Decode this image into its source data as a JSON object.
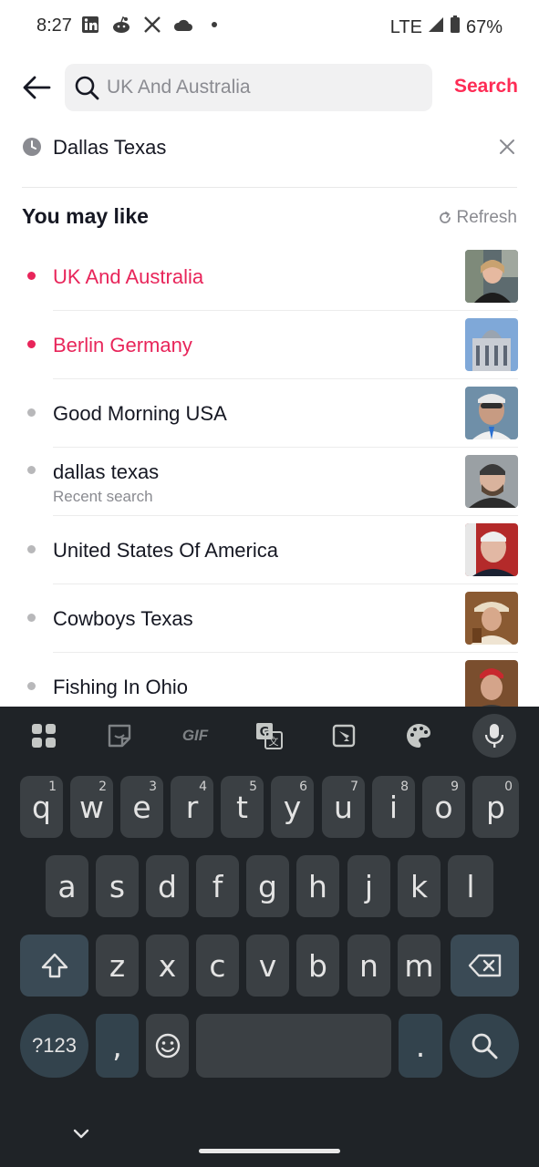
{
  "status_bar": {
    "time": "8:27",
    "network": "LTE",
    "battery": "67%"
  },
  "search": {
    "placeholder": "UK And Australia",
    "button_label": "Search"
  },
  "recent_search": {
    "label": "Dallas Texas"
  },
  "suggestions_section": {
    "title": "You may like",
    "refresh_label": "Refresh"
  },
  "suggestions": [
    {
      "text": "UK And Australia",
      "hot": true
    },
    {
      "text": "Berlin Germany",
      "hot": true
    },
    {
      "text": "Good Morning USA",
      "hot": false
    },
    {
      "text": "dallas texas",
      "subtext": "Recent search",
      "hot": false
    },
    {
      "text": "United States Of America",
      "hot": false
    },
    {
      "text": "Cowboys Texas",
      "hot": false
    },
    {
      "text": "Fishing In Ohio",
      "hot": false
    }
  ],
  "keyboard": {
    "toolbar_gif": "GIF",
    "row1": [
      {
        "key": "q",
        "hint": "1"
      },
      {
        "key": "w",
        "hint": "2"
      },
      {
        "key": "e",
        "hint": "3"
      },
      {
        "key": "r",
        "hint": "4"
      },
      {
        "key": "t",
        "hint": "5"
      },
      {
        "key": "y",
        "hint": "6"
      },
      {
        "key": "u",
        "hint": "7"
      },
      {
        "key": "i",
        "hint": "8"
      },
      {
        "key": "o",
        "hint": "9"
      },
      {
        "key": "p",
        "hint": "0"
      }
    ],
    "row2": [
      "a",
      "s",
      "d",
      "f",
      "g",
      "h",
      "j",
      "k",
      "l"
    ],
    "row3": [
      "z",
      "x",
      "c",
      "v",
      "b",
      "n",
      "m"
    ],
    "symbols_label": "?123",
    "comma": ",",
    "period": "."
  },
  "colors": {
    "accent": "#fe2c55",
    "hot_text": "#e8255a",
    "keyboard_bg": "#1f2327",
    "key_bg": "#3b4044"
  }
}
